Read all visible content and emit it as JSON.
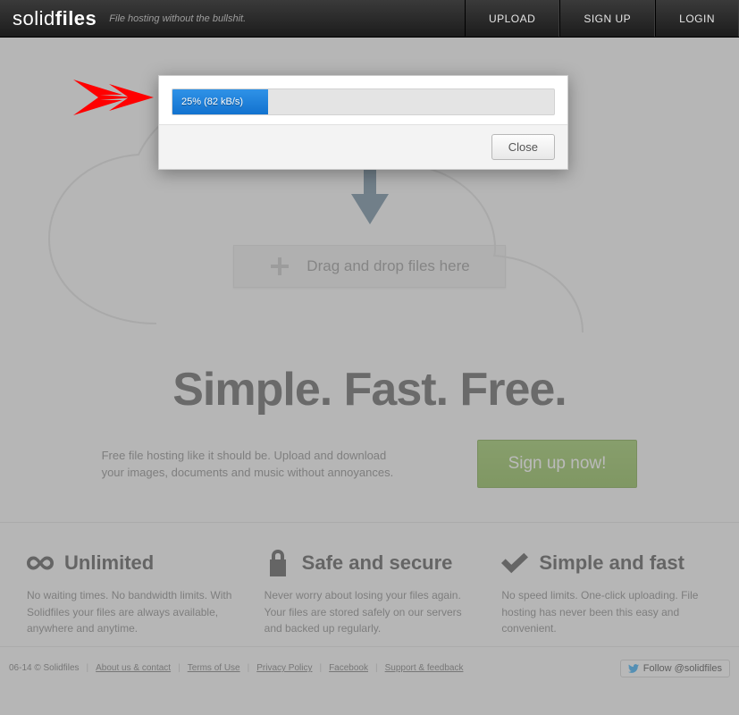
{
  "header": {
    "logo_light": "solid",
    "logo_bold": "files",
    "tagline": "File hosting without the bullshit.",
    "nav": {
      "upload": "UPLOAD",
      "signup": "SIGN UP",
      "login": "LOGIN"
    }
  },
  "hero": {
    "drop_text": "Drag and drop files here",
    "headline": "Simple. Fast. Free.",
    "subtext": "Free file hosting like it should be. Upload and download your images, documents and music without annoyances.",
    "signup_btn": "Sign up now!"
  },
  "features": [
    {
      "title": "Unlimited",
      "text": "No waiting times. No bandwidth limits. With Solidfiles your files are always available, anywhere and anytime."
    },
    {
      "title": "Safe and secure",
      "text": "Never worry about losing your files again. Your files are stored safely on our servers and backed up regularly."
    },
    {
      "title": "Simple and fast",
      "text": "No speed limits. One-click uploading. File hosting has never been this easy and convenient."
    }
  ],
  "footer": {
    "copyright": "06-14 © Solidfiles",
    "links": [
      "About us & contact",
      "Terms of Use",
      "Privacy Policy",
      "Facebook",
      "Support & feedback"
    ],
    "twitter_label": "Follow @solidfiles"
  },
  "modal": {
    "progress_percent": 25,
    "progress_text": "25% (82 kB/s)",
    "close": "Close"
  }
}
